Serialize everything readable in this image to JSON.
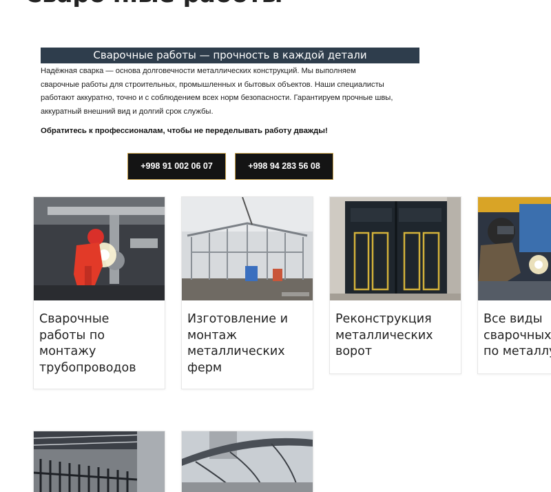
{
  "page": {
    "heading": "Сварочные работы"
  },
  "banner": {
    "title": "Сварочные работы — прочность в каждой детали"
  },
  "intro": {
    "lines": [
      "Надёжная сварка — основа долговечности металлических конструкций. Мы выполняем",
      "сварочные работы для строительных, промышленных и бытовых объектов. Наши специалисты",
      "работают аккуратно, точно и с соблюдением всех норм безопасности. Гарантируем прочные швы,",
      "аккуратный внешний вид и долгий срок службы."
    ],
    "cta": "Обратитесь к профессионалам, чтобы не переделывать работу дважды!"
  },
  "contacts": {
    "phone_1": "+998 91 002 06 07",
    "phone_2": "+998 94 283 56 08"
  },
  "services": [
    {
      "title_lines": [
        "Сварочные",
        "работы по",
        "монтажу",
        "трубопроводов"
      ],
      "image": "pipeline-welding-photo"
    },
    {
      "title_lines": [
        "Изготовление и",
        "монтаж",
        "металлических",
        "ферм"
      ],
      "image": "metal-truss-photo"
    },
    {
      "title_lines": [
        "Реконструкция",
        "металлических",
        "ворот"
      ],
      "image": "metal-gates-photo"
    },
    {
      "title_lines": [
        "Все виды",
        "сварочных",
        "по металлу"
      ],
      "image": "metal-welding-photo"
    },
    {
      "title_lines": [],
      "image": "warehouse-fence-photo"
    },
    {
      "title_lines": [],
      "image": "carport-canopy-photo"
    }
  ],
  "colors": {
    "banner_bg": "#2e3d4c",
    "button_bg": "#141414",
    "button_border": "#c9a24a",
    "gate_gold": "#d4b23a"
  }
}
